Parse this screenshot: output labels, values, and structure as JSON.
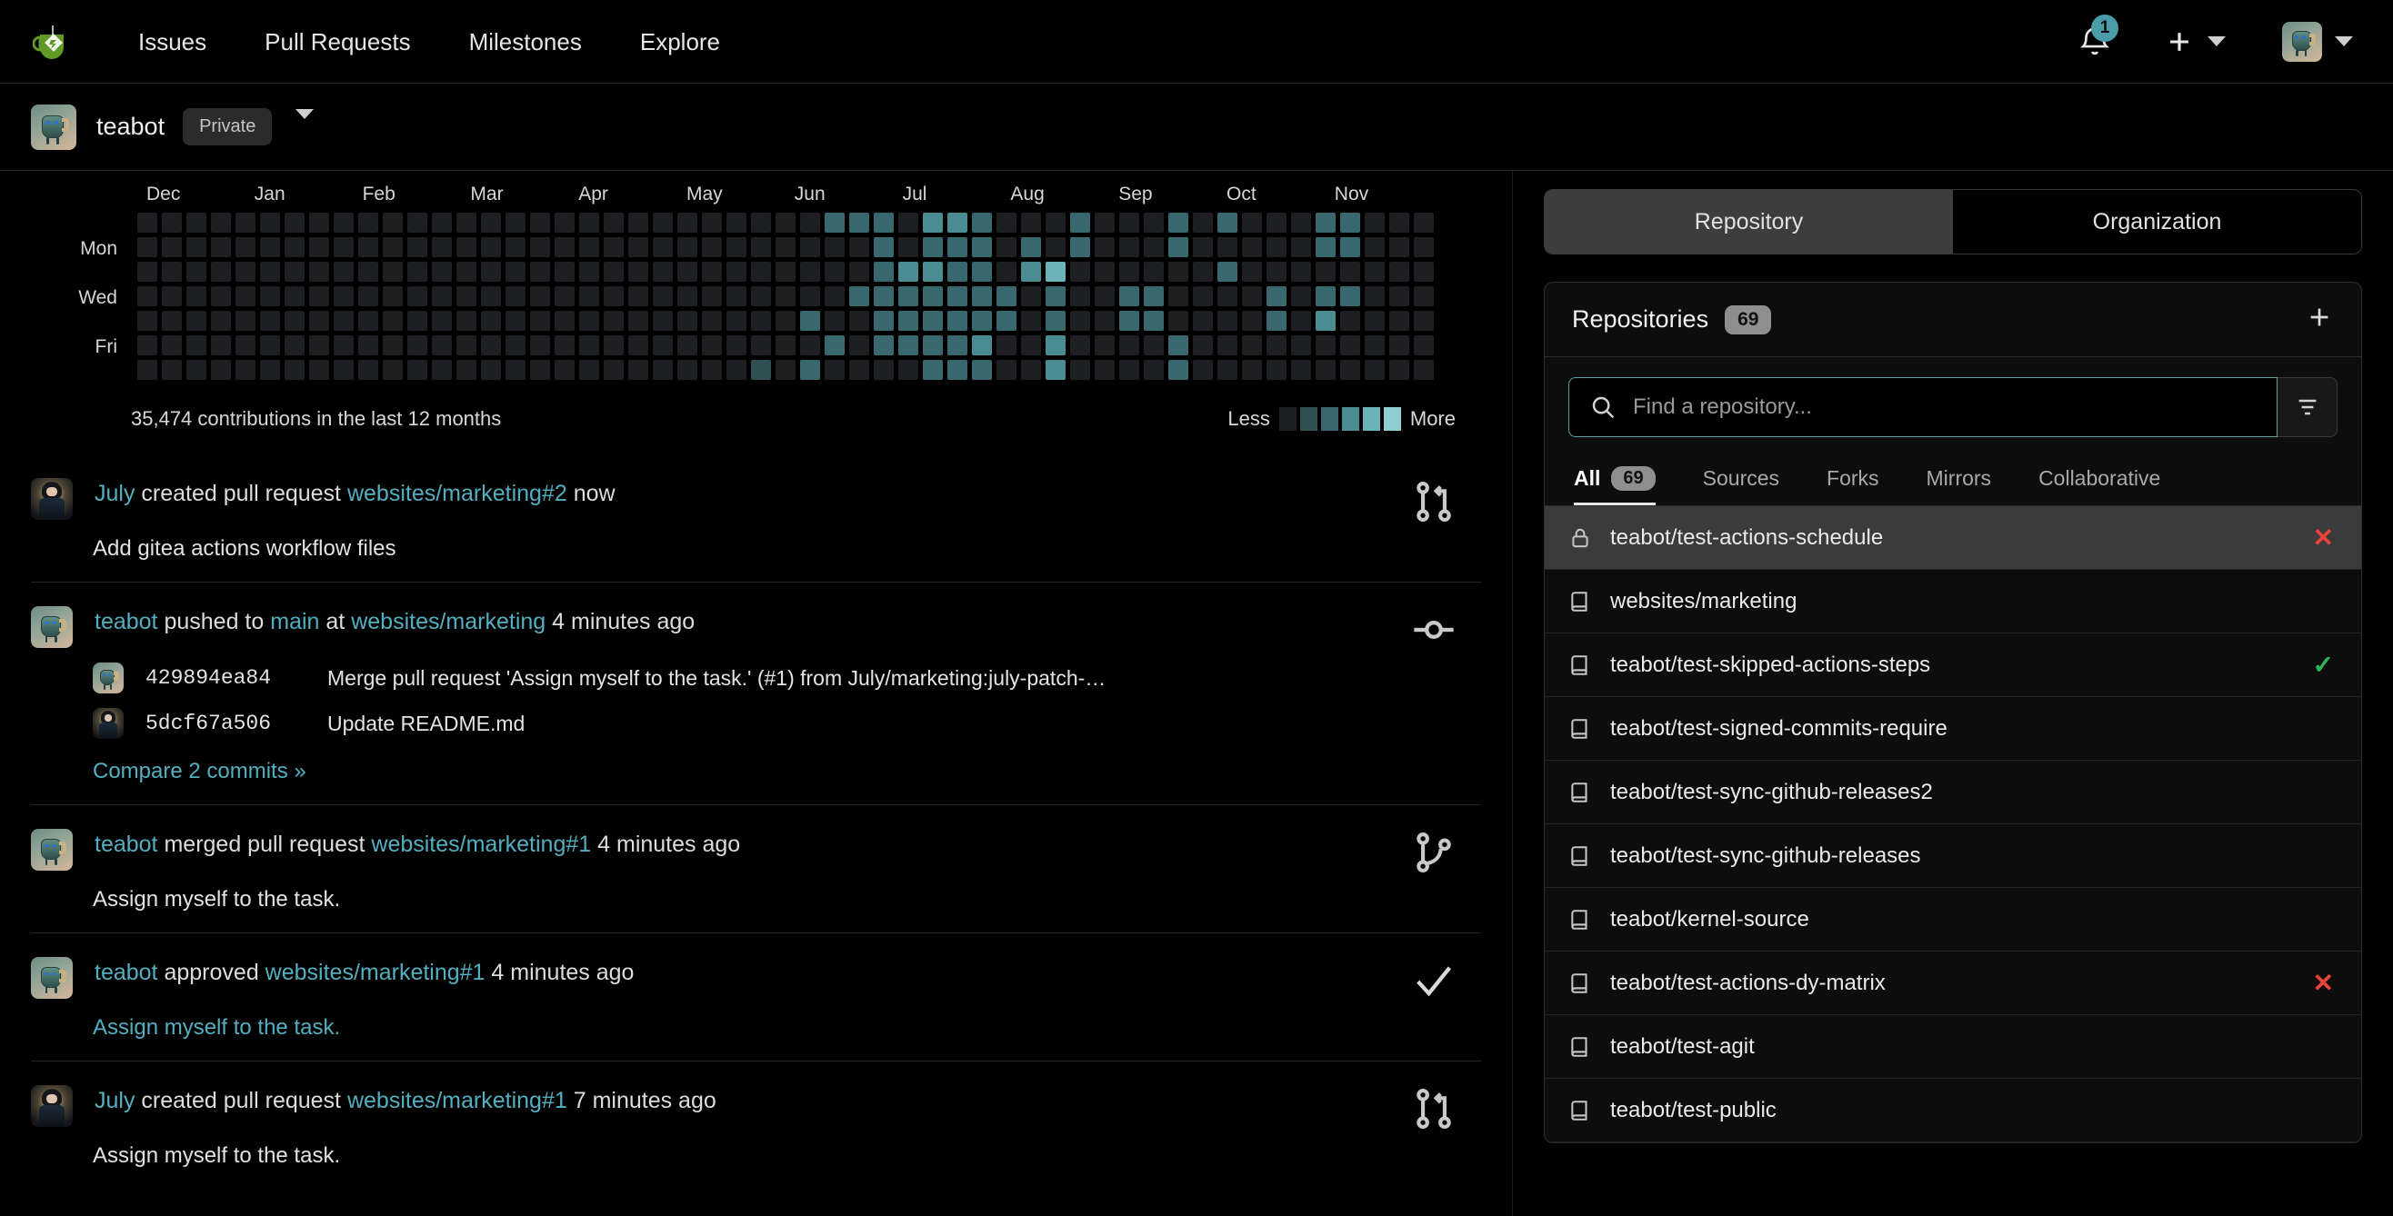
{
  "topnav": {
    "logo_icon": "gitea-teacup-logo",
    "links": [
      {
        "label": "Issues"
      },
      {
        "label": "Pull Requests"
      },
      {
        "label": "Milestones"
      },
      {
        "label": "Explore"
      }
    ],
    "notifications": {
      "icon": "bell-icon",
      "count": "1"
    },
    "create": {
      "icon": "plus-icon",
      "caret": "chevron-down-icon"
    },
    "user": {
      "avatar": "teabot-avatar",
      "caret": "chevron-down-icon"
    }
  },
  "owner": {
    "avatar": "teabot-avatar",
    "name": "teabot",
    "visibility": "Private",
    "caret": "chevron-down-icon"
  },
  "heatmap": {
    "months": [
      "Dec",
      "Jan",
      "Feb",
      "Mar",
      "Apr",
      "May",
      "Jun",
      "Jul",
      "Aug",
      "Sep",
      "Oct",
      "Nov"
    ],
    "day_labels": [
      "Mon",
      "Wed",
      "Fri"
    ],
    "contributions_text": "35,474 contributions in the last 12 months",
    "legend_less": "Less",
    "legend_more": "More",
    "palette": [
      "#1e1f22",
      "#2f4f52",
      "#38686e",
      "#4b8c93",
      "#6cb3b8",
      "#8fcdd0"
    ],
    "weeks": 53,
    "levels": [
      [
        0,
        0,
        0,
        0,
        0,
        0,
        0
      ],
      [
        0,
        0,
        0,
        0,
        0,
        0,
        0
      ],
      [
        0,
        0,
        0,
        0,
        0,
        0,
        0
      ],
      [
        0,
        0,
        0,
        0,
        0,
        0,
        0
      ],
      [
        0,
        0,
        0,
        0,
        0,
        0,
        0
      ],
      [
        0,
        0,
        0,
        0,
        0,
        0,
        0
      ],
      [
        0,
        0,
        0,
        0,
        0,
        0,
        0
      ],
      [
        0,
        0,
        0,
        0,
        0,
        0,
        0
      ],
      [
        0,
        0,
        0,
        0,
        0,
        0,
        0
      ],
      [
        0,
        0,
        0,
        0,
        0,
        0,
        0
      ],
      [
        0,
        0,
        0,
        0,
        0,
        0,
        0
      ],
      [
        0,
        0,
        0,
        0,
        0,
        0,
        0
      ],
      [
        0,
        0,
        0,
        0,
        0,
        0,
        0
      ],
      [
        0,
        0,
        0,
        0,
        0,
        0,
        0
      ],
      [
        0,
        0,
        0,
        0,
        0,
        0,
        0
      ],
      [
        0,
        0,
        0,
        0,
        0,
        0,
        0
      ],
      [
        0,
        0,
        0,
        0,
        0,
        0,
        0
      ],
      [
        0,
        0,
        0,
        0,
        0,
        0,
        0
      ],
      [
        0,
        0,
        0,
        0,
        0,
        0,
        0
      ],
      [
        0,
        0,
        0,
        0,
        0,
        0,
        0
      ],
      [
        0,
        0,
        0,
        0,
        0,
        0,
        0
      ],
      [
        0,
        0,
        0,
        0,
        0,
        0,
        0
      ],
      [
        0,
        0,
        0,
        0,
        0,
        0,
        0
      ],
      [
        0,
        0,
        0,
        0,
        0,
        0,
        0
      ],
      [
        0,
        0,
        0,
        0,
        0,
        0,
        0
      ],
      [
        0,
        0,
        0,
        0,
        0,
        0,
        1
      ],
      [
        0,
        0,
        0,
        0,
        0,
        0,
        0
      ],
      [
        0,
        0,
        0,
        0,
        2,
        0,
        2
      ],
      [
        2,
        0,
        0,
        0,
        0,
        2,
        0
      ],
      [
        2,
        0,
        0,
        2,
        0,
        0,
        0
      ],
      [
        2,
        2,
        2,
        2,
        2,
        2,
        0
      ],
      [
        0,
        0,
        3,
        2,
        2,
        2,
        0
      ],
      [
        3,
        2,
        3,
        2,
        2,
        2,
        2
      ],
      [
        3,
        2,
        2,
        2,
        2,
        2,
        2
      ],
      [
        2,
        2,
        2,
        2,
        2,
        3,
        2
      ],
      [
        0,
        0,
        0,
        2,
        2,
        0,
        0
      ],
      [
        0,
        2,
        3,
        0,
        0,
        0,
        0
      ],
      [
        0,
        0,
        4,
        2,
        2,
        3,
        3
      ],
      [
        2,
        2,
        0,
        0,
        0,
        0,
        0
      ],
      [
        0,
        0,
        0,
        0,
        0,
        0,
        0
      ],
      [
        0,
        0,
        0,
        2,
        2,
        0,
        0
      ],
      [
        0,
        0,
        0,
        2,
        2,
        0,
        0
      ],
      [
        2,
        2,
        0,
        0,
        0,
        2,
        2
      ],
      [
        0,
        0,
        0,
        0,
        0,
        0,
        0
      ],
      [
        2,
        0,
        2,
        0,
        0,
        0,
        0
      ],
      [
        0,
        0,
        0,
        0,
        0,
        0,
        0
      ],
      [
        0,
        0,
        0,
        2,
        2,
        0,
        0
      ],
      [
        0,
        0,
        0,
        0,
        0,
        0,
        0
      ],
      [
        2,
        2,
        0,
        2,
        3,
        0,
        0
      ],
      [
        2,
        2,
        0,
        2,
        0,
        0,
        0
      ],
      [
        0,
        0,
        0,
        0,
        0,
        0,
        0
      ],
      [
        0,
        0,
        0,
        0,
        0,
        0,
        0
      ],
      [
        0,
        0,
        0,
        0,
        0,
        0,
        0
      ]
    ]
  },
  "feed": [
    {
      "avatar": "july-avatar",
      "actor": "July",
      "action": "created pull request",
      "target": "websites/marketing#2",
      "time": "now",
      "body": "Add gitea actions workflow files",
      "body_is_link": false,
      "icon": "pull-request-icon"
    },
    {
      "avatar": "teabot-avatar",
      "actor": "teabot",
      "action": "pushed to",
      "branch": "main",
      "at": "at",
      "target": "websites/marketing",
      "time": "4 minutes ago",
      "icon": "commit-icon",
      "commits": [
        {
          "avatar": "teabot-avatar",
          "sha": "429894ea84",
          "message": "Merge pull request 'Assign myself to the task.' (#1) from July/marketing:july-patch-…",
          "ref": "#1"
        },
        {
          "avatar": "july-avatar",
          "sha": "5dcf67a506",
          "message": "Update README.md"
        }
      ],
      "compare_label": "Compare 2 commits »"
    },
    {
      "avatar": "teabot-avatar",
      "actor": "teabot",
      "action": "merged pull request",
      "target": "websites/marketing#1",
      "time": "4 minutes ago",
      "body": "Assign myself to the task.",
      "body_is_link": false,
      "icon": "merge-icon"
    },
    {
      "avatar": "teabot-avatar",
      "actor": "teabot",
      "action": "approved",
      "target": "websites/marketing#1",
      "time": "4 minutes ago",
      "body": "Assign myself to the task.",
      "body_is_link": true,
      "icon": "check-icon"
    },
    {
      "avatar": "july-avatar",
      "actor": "July",
      "action": "created pull request",
      "target": "websites/marketing#1",
      "time": "7 minutes ago",
      "body": "Assign myself to the task.",
      "body_is_link": false,
      "icon": "pull-request-icon"
    }
  ],
  "sidebar": {
    "segments": [
      {
        "label": "Repository",
        "active": true
      },
      {
        "label": "Organization",
        "active": false
      }
    ],
    "panel_title": "Repositories",
    "panel_count": "69",
    "add_icon": "plus-icon",
    "search": {
      "icon": "search-icon",
      "placeholder": "Find a repository...",
      "value": ""
    },
    "filter_icon": "filter-icon",
    "filter_tabs": [
      {
        "label": "All",
        "count": "69",
        "active": true
      },
      {
        "label": "Sources",
        "active": false
      },
      {
        "label": "Forks",
        "active": false
      },
      {
        "label": "Mirrors",
        "active": false
      },
      {
        "label": "Collaborative",
        "active": false
      }
    ],
    "repos": [
      {
        "name": "teabot/test-actions-schedule",
        "icon": "lock-icon",
        "status": "fail",
        "status_glyph": "✕",
        "selected": true
      },
      {
        "name": "websites/marketing",
        "icon": "repo-icon",
        "status": "",
        "status_glyph": "",
        "selected": false
      },
      {
        "name": "teabot/test-skipped-actions-steps",
        "icon": "repo-icon",
        "status": "ok",
        "status_glyph": "✓",
        "selected": false
      },
      {
        "name": "teabot/test-signed-commits-require",
        "icon": "repo-icon",
        "status": "",
        "status_glyph": "",
        "selected": false
      },
      {
        "name": "teabot/test-sync-github-releases2",
        "icon": "repo-icon",
        "status": "",
        "status_glyph": "",
        "selected": false
      },
      {
        "name": "teabot/test-sync-github-releases",
        "icon": "repo-icon",
        "status": "",
        "status_glyph": "",
        "selected": false
      },
      {
        "name": "teabot/kernel-source",
        "icon": "repo-icon",
        "status": "",
        "status_glyph": "",
        "selected": false
      },
      {
        "name": "teabot/test-actions-dy-matrix",
        "icon": "repo-icon",
        "status": "fail",
        "status_glyph": "✕",
        "selected": false
      },
      {
        "name": "teabot/test-agit",
        "icon": "repo-icon",
        "status": "",
        "status_glyph": "",
        "selected": false
      },
      {
        "name": "teabot/test-public",
        "icon": "repo-icon",
        "status": "",
        "status_glyph": "",
        "selected": false
      }
    ]
  }
}
